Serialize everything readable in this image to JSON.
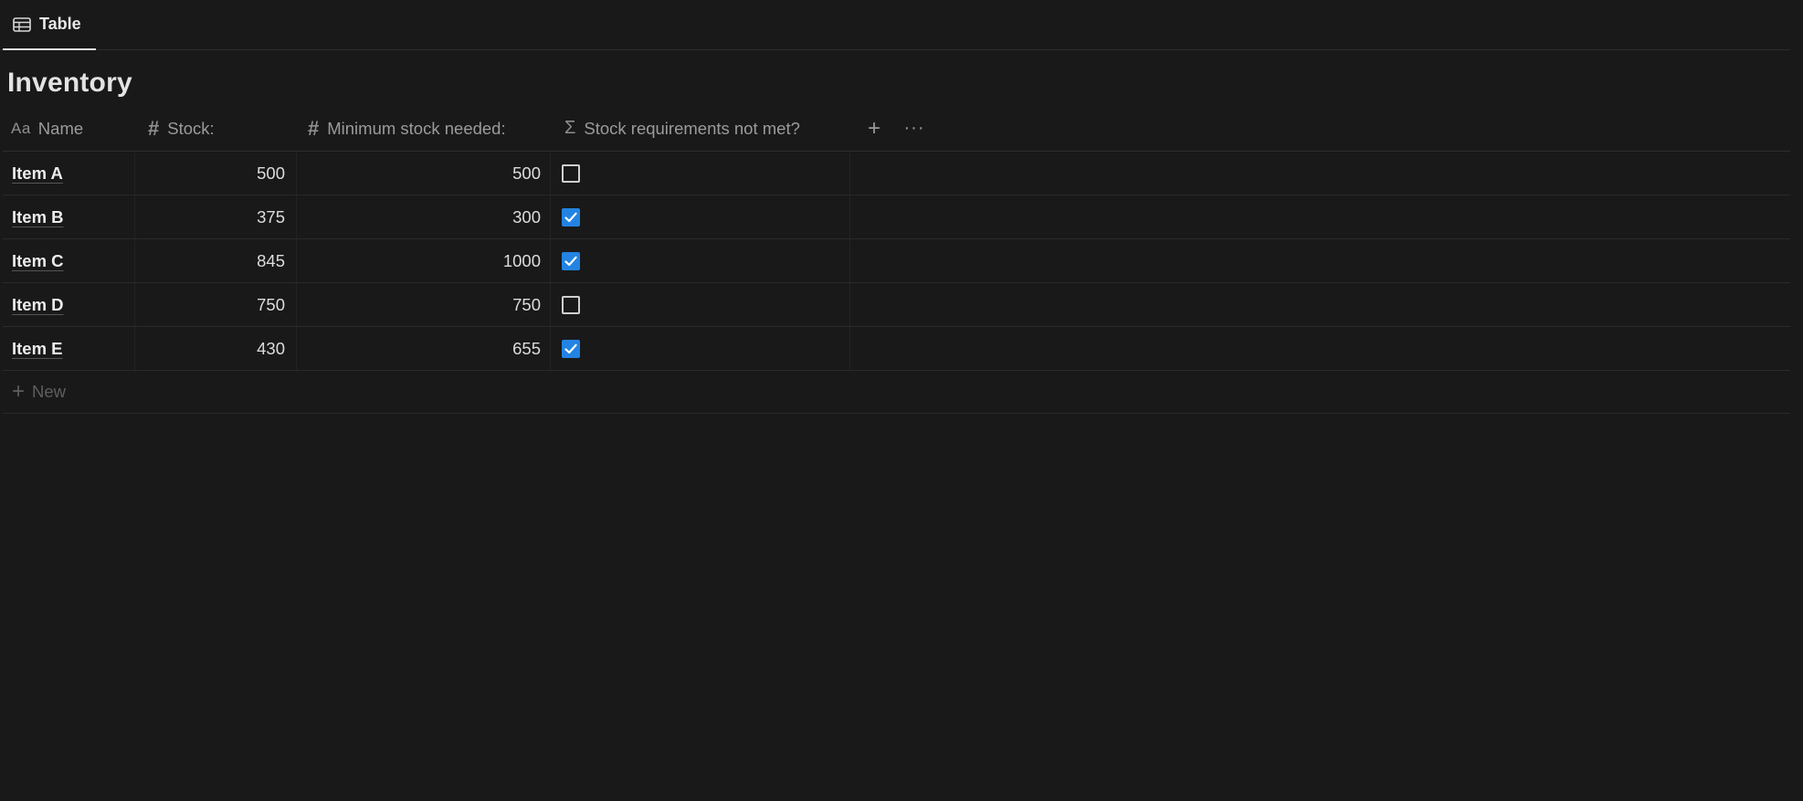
{
  "view_tabs": [
    {
      "label": "Table",
      "icon": "table-icon",
      "active": true
    }
  ],
  "title": "Inventory",
  "columns": [
    {
      "icon": "text-property-icon",
      "glyph": "Aa",
      "label": "Name"
    },
    {
      "icon": "number-property-icon",
      "glyph": "#",
      "label": "Stock:"
    },
    {
      "icon": "number-property-icon",
      "glyph": "#",
      "label": "Minimum stock needed:"
    },
    {
      "icon": "formula-property-icon",
      "glyph": "Σ",
      "label": "Stock requirements not met?"
    }
  ],
  "header_actions": {
    "add": "+",
    "more": "···"
  },
  "rows": [
    {
      "name": "Item A",
      "stock": "500",
      "minimum": "500",
      "not_met": false
    },
    {
      "name": "Item B",
      "stock": "375",
      "minimum": "300",
      "not_met": true
    },
    {
      "name": "Item C",
      "stock": "845",
      "minimum": "1000",
      "not_met": true
    },
    {
      "name": "Item D",
      "stock": "750",
      "minimum": "750",
      "not_met": false
    },
    {
      "name": "Item E",
      "stock": "430",
      "minimum": "655",
      "not_met": true
    }
  ],
  "new_row": {
    "plus": "+",
    "label": "New"
  },
  "colors": {
    "background": "#191919",
    "checkbox_checked": "#2383e2"
  }
}
